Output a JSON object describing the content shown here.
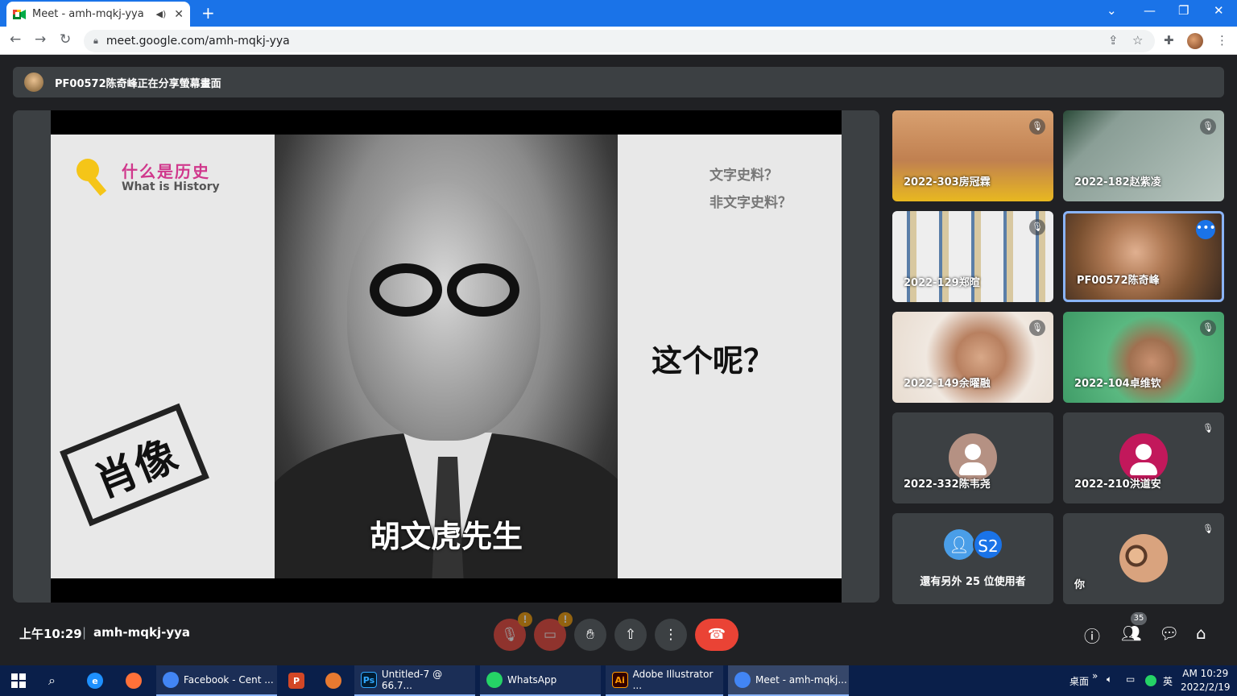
{
  "browser": {
    "tab_title": "Meet - amh-mqkj-yya",
    "url": "meet.google.com/amh-mqkj-yya"
  },
  "banner": {
    "text": "PF00572陈奇峰正在分享螢幕畫面"
  },
  "slide": {
    "title_zh": "什么是历史",
    "title_en": "What is History",
    "stamp": "肖像",
    "caption": "胡文虎先生",
    "question1": "文字史料？",
    "question2": "非文字史料？",
    "question3": "这个呢？"
  },
  "tiles": [
    {
      "name": "2022-303房冠霖"
    },
    {
      "name": "2022-182赵紫凌"
    },
    {
      "name": "2022-129郑暄"
    },
    {
      "name": "PF00572陈奇峰"
    },
    {
      "name": "2022-149余曜融"
    },
    {
      "name": "2022-104卓维钦"
    },
    {
      "name": "2022-332陈韦尧",
      "avatar_color": "#b59183"
    },
    {
      "name": "2022-210洪道安",
      "avatar_color": "#c2185b"
    },
    {
      "others_text": "還有另外 25 位使用者",
      "s2_label": "S2"
    },
    {
      "name": "你"
    }
  ],
  "controls": {
    "time": "上午10:29",
    "separator": "|",
    "meeting_code": "amh-mqkj-yya",
    "people_count": "35"
  },
  "taskbar": {
    "items": [
      {
        "label": "Facebook - Cent ..."
      },
      {
        "label": "Untitled-7 @ 66.7..."
      },
      {
        "label": "WhatsApp"
      },
      {
        "label": "Adobe Illustrator ..."
      },
      {
        "label": "Meet - amh-mqkj..."
      }
    ],
    "tray_desktop": "桌面",
    "tray_lang": "英",
    "clock_time": "AM 10:29",
    "clock_date": "2022/2/19"
  },
  "icons": [
    "meet-icon",
    "speaker-icon",
    "close-icon",
    "plus-icon",
    "back-icon",
    "forward-icon",
    "reload-icon",
    "lock-icon",
    "share-icon",
    "star-icon",
    "extension-icon",
    "menu-icon",
    "mic-off-icon",
    "camera-off-icon",
    "hand-icon",
    "present-icon",
    "more-icon",
    "hangup-icon",
    "info-icon",
    "people-icon",
    "chat-icon",
    "activities-icon",
    "windows-icon",
    "search-icon"
  ]
}
